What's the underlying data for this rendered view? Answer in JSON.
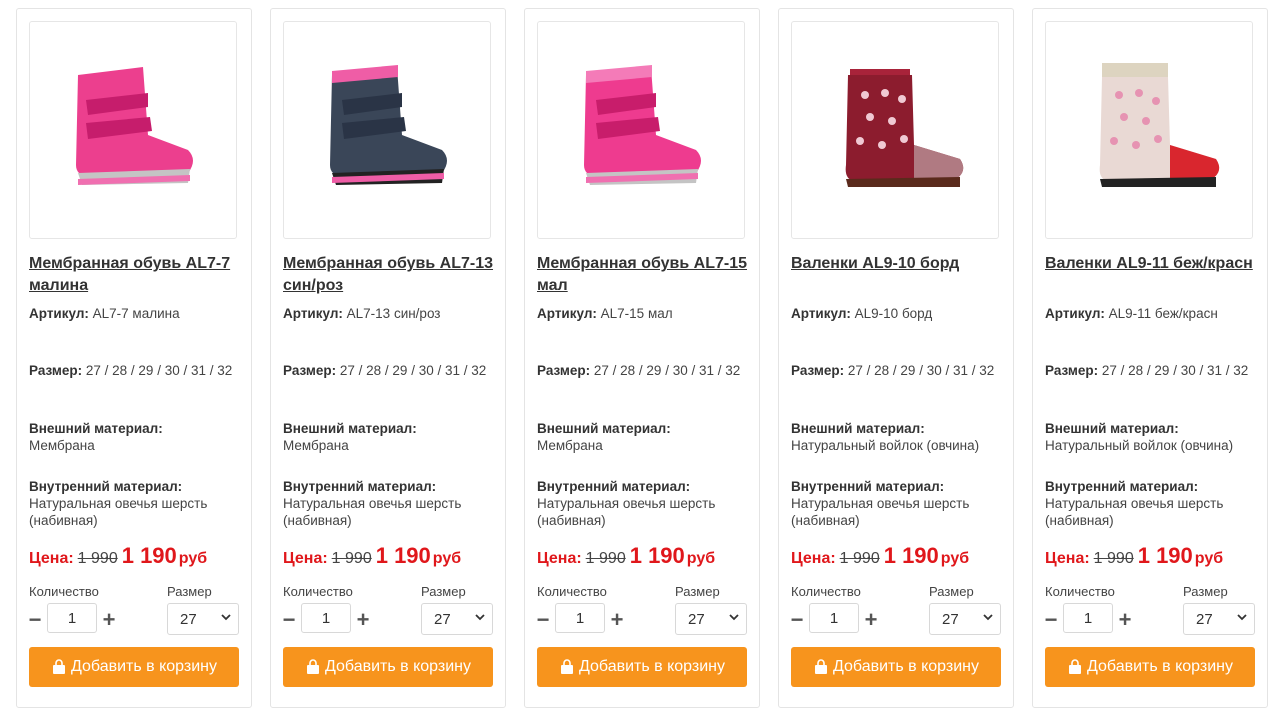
{
  "labels": {
    "article": "Артикул:",
    "size": "Размер:",
    "outer": "Внешний материал:",
    "inner": "Внутренний материал:",
    "price": "Цена:",
    "currency": "руб",
    "quantity": "Количество",
    "size_select": "Размер",
    "add_to_cart": "Добавить в корзину"
  },
  "colors": {
    "accent": "#f7941d",
    "price": "#e0171b"
  },
  "products": [
    {
      "name": "Мембранная обувь AL7-7 малина",
      "article": "AL7-7 малина",
      "sizes": "27 / 28 / 29 / 30 / 31 / 32",
      "outer": "Мембрана",
      "inner": "Натуральная овечья шерсть (набивная)",
      "old_price": "1 990",
      "new_price": "1 190",
      "quantity": "1",
      "size_selected": "27",
      "image_icon": "boot-icon"
    },
    {
      "name": "Мембранная обувь AL7-13 син/роз",
      "article": "AL7-13 син/роз",
      "sizes": "27 / 28 / 29 / 30 / 31 / 32",
      "outer": "Мембрана",
      "inner": "Натуральная овечья шерсть (набивная)",
      "old_price": "1 990",
      "new_price": "1 190",
      "quantity": "1",
      "size_selected": "27",
      "image_icon": "boot-icon"
    },
    {
      "name": "Мембранная обувь AL7-15 мал",
      "article": "AL7-15 мал",
      "sizes": "27 / 28 / 29 / 30 / 31 / 32",
      "outer": "Мембрана",
      "inner": "Натуральная овечья шерсть (набивная)",
      "old_price": "1 990",
      "new_price": "1 190",
      "quantity": "1",
      "size_selected": "27",
      "image_icon": "boot-icon"
    },
    {
      "name": "Валенки AL9-10 борд",
      "article": "AL9-10 борд",
      "sizes": "27 / 28 / 29 / 30 / 31 / 32",
      "outer": "Натуральный войлок (овчина)",
      "inner": "Натуральная овечья шерсть (набивная)",
      "old_price": "1 990",
      "new_price": "1 190",
      "quantity": "1",
      "size_selected": "27",
      "image_icon": "valenki-icon"
    },
    {
      "name": "Валенки AL9-11 беж/красн",
      "article": "AL9-11 беж/красн",
      "sizes": "27 / 28 / 29 / 30 / 31 / 32",
      "outer": "Натуральный войлок (овчина)",
      "inner": "Натуральная овечья шерсть (набивная)",
      "old_price": "1 990",
      "new_price": "1 190",
      "quantity": "1",
      "size_selected": "27",
      "image_icon": "valenki-icon"
    }
  ]
}
